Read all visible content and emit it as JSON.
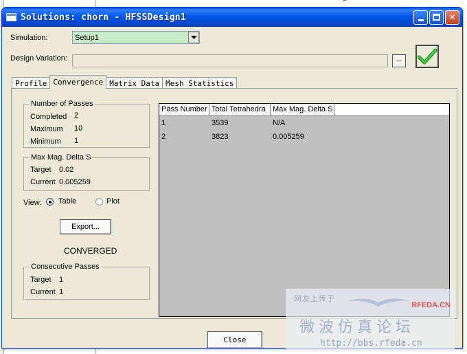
{
  "window": {
    "title": "Solutions: chorn - HFSSDesign1",
    "minimize_label": "",
    "close_glyph": "✕"
  },
  "simulation": {
    "label": "Simulation:",
    "selected": "Setup1"
  },
  "design_variation": {
    "label": "Design Variation:",
    "value": "",
    "browse_label": "..."
  },
  "tabs": [
    {
      "label": "Profile",
      "active": false
    },
    {
      "label": "Convergence",
      "active": true
    },
    {
      "label": "Matrix Data",
      "active": false
    },
    {
      "label": "Mesh Statistics",
      "active": false
    }
  ],
  "passes": {
    "title": "Number of Passes",
    "completed_label": "Completed",
    "completed": "2",
    "maximum_label": "Maximum",
    "maximum": "10",
    "minimum_label": "Minimum",
    "minimum": "1"
  },
  "delta": {
    "title": "Max Mag. Delta S",
    "target_label": "Target",
    "target": "0.02",
    "current_label": "Current",
    "current": "0.005259"
  },
  "view": {
    "label": "View:",
    "table_label": "Table",
    "plot_label": "Plot",
    "selected": "Table"
  },
  "export_label": "Export...",
  "status": "CONVERGED",
  "consecutive": {
    "title": "Consecutive Passes",
    "target_label": "Target",
    "target": "1",
    "current_label": "Current",
    "current": "1"
  },
  "table": {
    "headers": [
      "Pass Number",
      "Total Tetrahedra",
      "Max Mag. Delta S"
    ],
    "rows": [
      [
        "1",
        "3539",
        "N/A"
      ],
      [
        "2",
        "3823",
        "0.005259"
      ]
    ]
  },
  "close_label": "Close",
  "watermark": {
    "small": "网友上传于",
    "brand": "RFEDA.CN",
    "big": "微波仿真论坛",
    "url": "http://bbs.rfeda.cn"
  },
  "colors": {
    "titlebar": "#0058e6",
    "window_bg": "#ece9d8",
    "combo_bg": "#c6ebc6",
    "grid_bg": "#c0c0c0",
    "check": "#2db82d"
  }
}
